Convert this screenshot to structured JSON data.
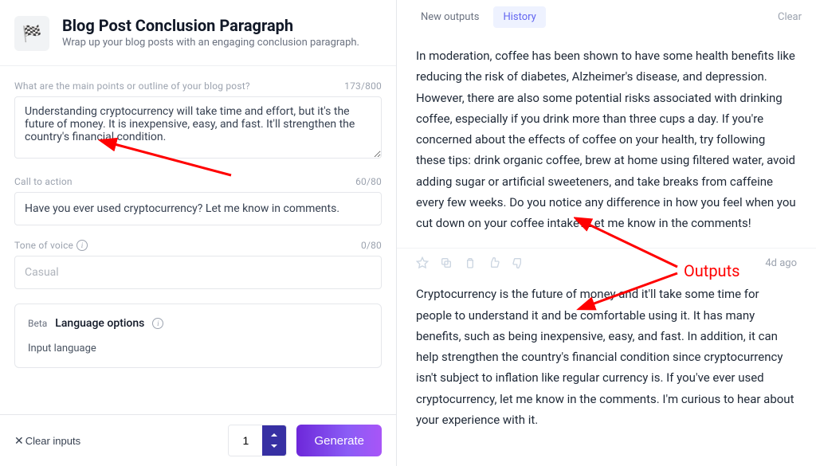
{
  "header": {
    "title": "Blog Post Conclusion Paragraph",
    "subtitle": "Wrap up your blog posts with an engaging conclusion paragraph.",
    "icon": "🏁"
  },
  "fields": {
    "mainPoints": {
      "label": "What are the main points or outline of your blog post?",
      "counter": "173/800",
      "value": "Understanding cryptocurrency will take time and effort, but it's the future of money. It is inexpensive, easy, and fast. It'll strengthen the country's financial condition."
    },
    "cta": {
      "label": "Call to action",
      "counter": "60/80",
      "value": "Have you ever used cryptocurrency? Let me know in comments."
    },
    "tone": {
      "label": "Tone of voice",
      "counter": "0/80",
      "placeholder": "Casual"
    }
  },
  "languageBox": {
    "beta": "Beta",
    "title": "Language options",
    "subLabel": "Input language"
  },
  "bottomBar": {
    "clearLabel": "Clear inputs",
    "countValue": "1",
    "generateLabel": "Generate"
  },
  "tabs": {
    "newOutputs": "New outputs",
    "history": "History",
    "clear": "Clear"
  },
  "outputs": [
    {
      "text": "In moderation, coffee has been shown to have some health benefits like reducing the risk of diabetes, Alzheimer's disease, and depression. However, there are also some potential risks associated with drinking coffee, especially if you drink more than three cups a day. If you're concerned about the effects of coffee on your health, try following these tips: drink organic coffee, brew at home using filtered water, avoid adding sugar or artificial sweeteners, and take breaks from caffeine every few weeks. Do you notice any difference in how you feel when you cut down on your coffee intake? Let me know in the comments!"
    },
    {
      "text": "Cryptocurrency is the future of money and it'll take some time for people to understand it and be comfortable using it. It has many benefits, such as being inexpensive, easy, and fast. In addition, it can help strengthen the country's financial condition since cryptocurrency isn't subject to inflation like regular currency is. If you've ever used cryptocurrency, let me know in the comments. I'm curious to hear about your experience with it.",
      "time": "4d ago"
    }
  ],
  "annotation": {
    "outputsLabel": "Outputs"
  }
}
